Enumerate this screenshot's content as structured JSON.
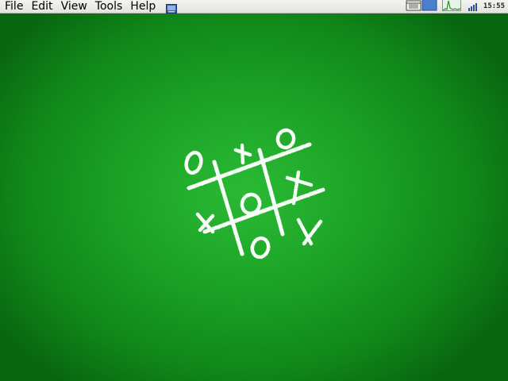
{
  "menubar": {
    "items": [
      {
        "label": "File"
      },
      {
        "label": "Edit"
      },
      {
        "label": "View"
      },
      {
        "label": "Tools"
      },
      {
        "label": "Help"
      }
    ],
    "launcher_icon": "terminal-icon"
  },
  "tray": {
    "icons": [
      "window-list-icon",
      "workspace-switcher-icon",
      "cpu-monitor-icon",
      "network-signal-icon"
    ],
    "clock": "15:55"
  },
  "desktop": {
    "wallpaper": "chalk tic-tac-toe",
    "colors": {
      "green_light": "#2fc23a",
      "green_dark": "#0a6612",
      "chalk": "#ffffff"
    },
    "board": {
      "cells": [
        "O",
        "X",
        "O",
        "X",
        "O",
        "X",
        "",
        "O",
        "X"
      ]
    }
  }
}
